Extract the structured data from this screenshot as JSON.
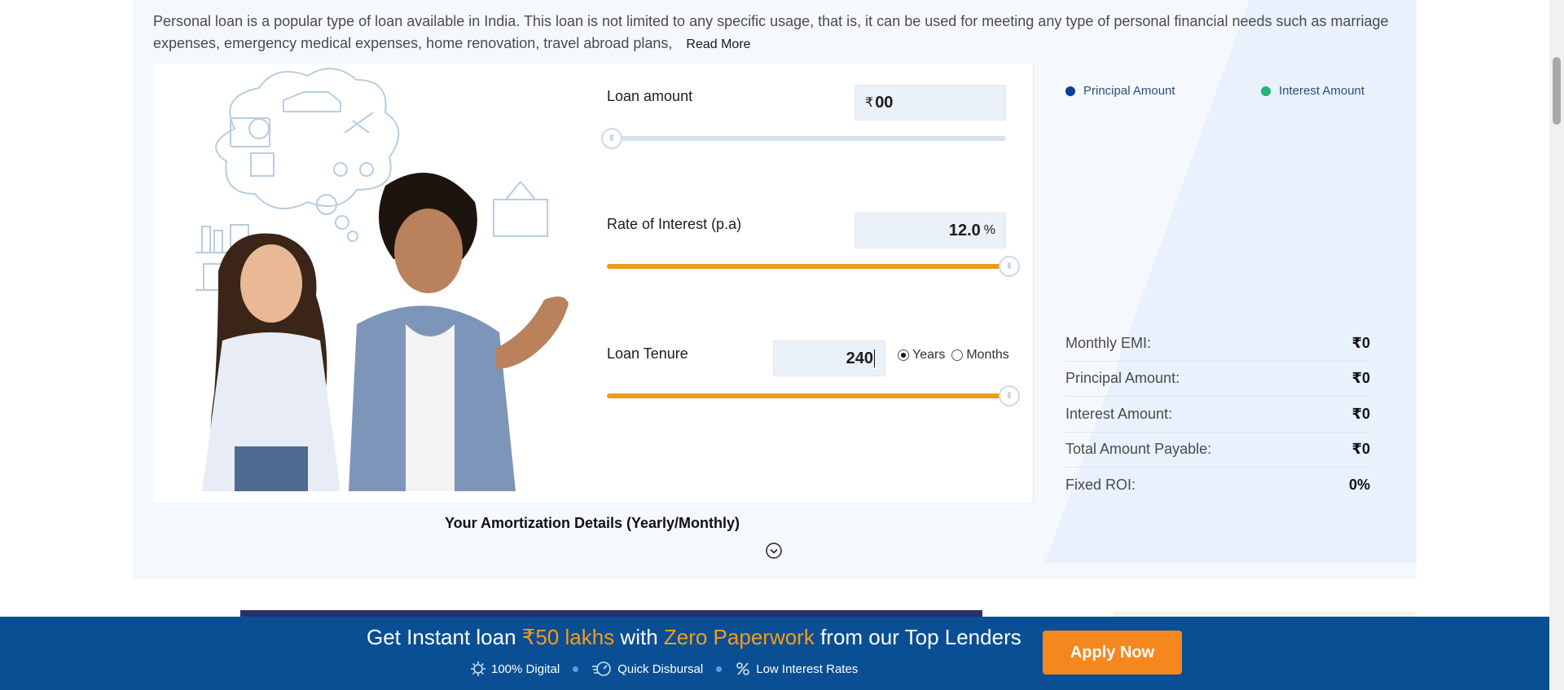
{
  "intro": {
    "text": "Personal loan is a popular type of loan available in India. This loan is not limited to any specific usage, that is, it can be used for meeting any type of personal financial needs such as marriage expenses, emergency medical expenses, home renovation, travel abroad plans,",
    "read_more": "Read More"
  },
  "calculator": {
    "loan_amount": {
      "label": "Loan amount",
      "currency": "₹",
      "value": "00",
      "slider_fraction": 0.0
    },
    "interest_rate": {
      "label": "Rate of Interest (p.a)",
      "value": "12.0",
      "unit": "%",
      "slider_fraction": 1.0
    },
    "tenure": {
      "label": "Loan Tenure",
      "value": "240",
      "slider_fraction": 1.0,
      "options": [
        "Years",
        "Months"
      ],
      "selected": "Years"
    }
  },
  "colors": {
    "slider_active": "#ee9a1c",
    "slider_inactive": "#d6e1ec",
    "principal": "#0a3e9c",
    "interest": "#22b573",
    "banner_bg": "#0a4f93",
    "button": "#f5871f",
    "highlight": "#f39c1f"
  },
  "legend": {
    "principal": "Principal Amount",
    "interest": "Interest Amount"
  },
  "summary": [
    {
      "label": "Monthly EMI:",
      "value": "₹0"
    },
    {
      "label": "Principal Amount:",
      "value": "₹0"
    },
    {
      "label": "Interest Amount:",
      "value": "₹0"
    },
    {
      "label": "Total Amount Payable:",
      "value": "₹0"
    },
    {
      "label": "Fixed ROI:",
      "value": "0%"
    }
  ],
  "amortization": {
    "title": "Your Amortization Details (Yearly/Monthly)",
    "toggle_icon": "chevron-down-circle-icon"
  },
  "banner": {
    "title_pre": "Get Instant loan ",
    "title_hl1": "₹50 lakhs",
    "title_mid": " with ",
    "title_hl2": "Zero Paperwork",
    "title_post": " from our Top Lenders",
    "features": [
      {
        "label": "100% Digital",
        "icon": "gear-badge-icon"
      },
      {
        "label": "Quick Disbursal",
        "icon": "speed-icon"
      },
      {
        "label": "Low Interest Rates",
        "icon": "percent-icon"
      }
    ],
    "cta": "Apply Now"
  }
}
